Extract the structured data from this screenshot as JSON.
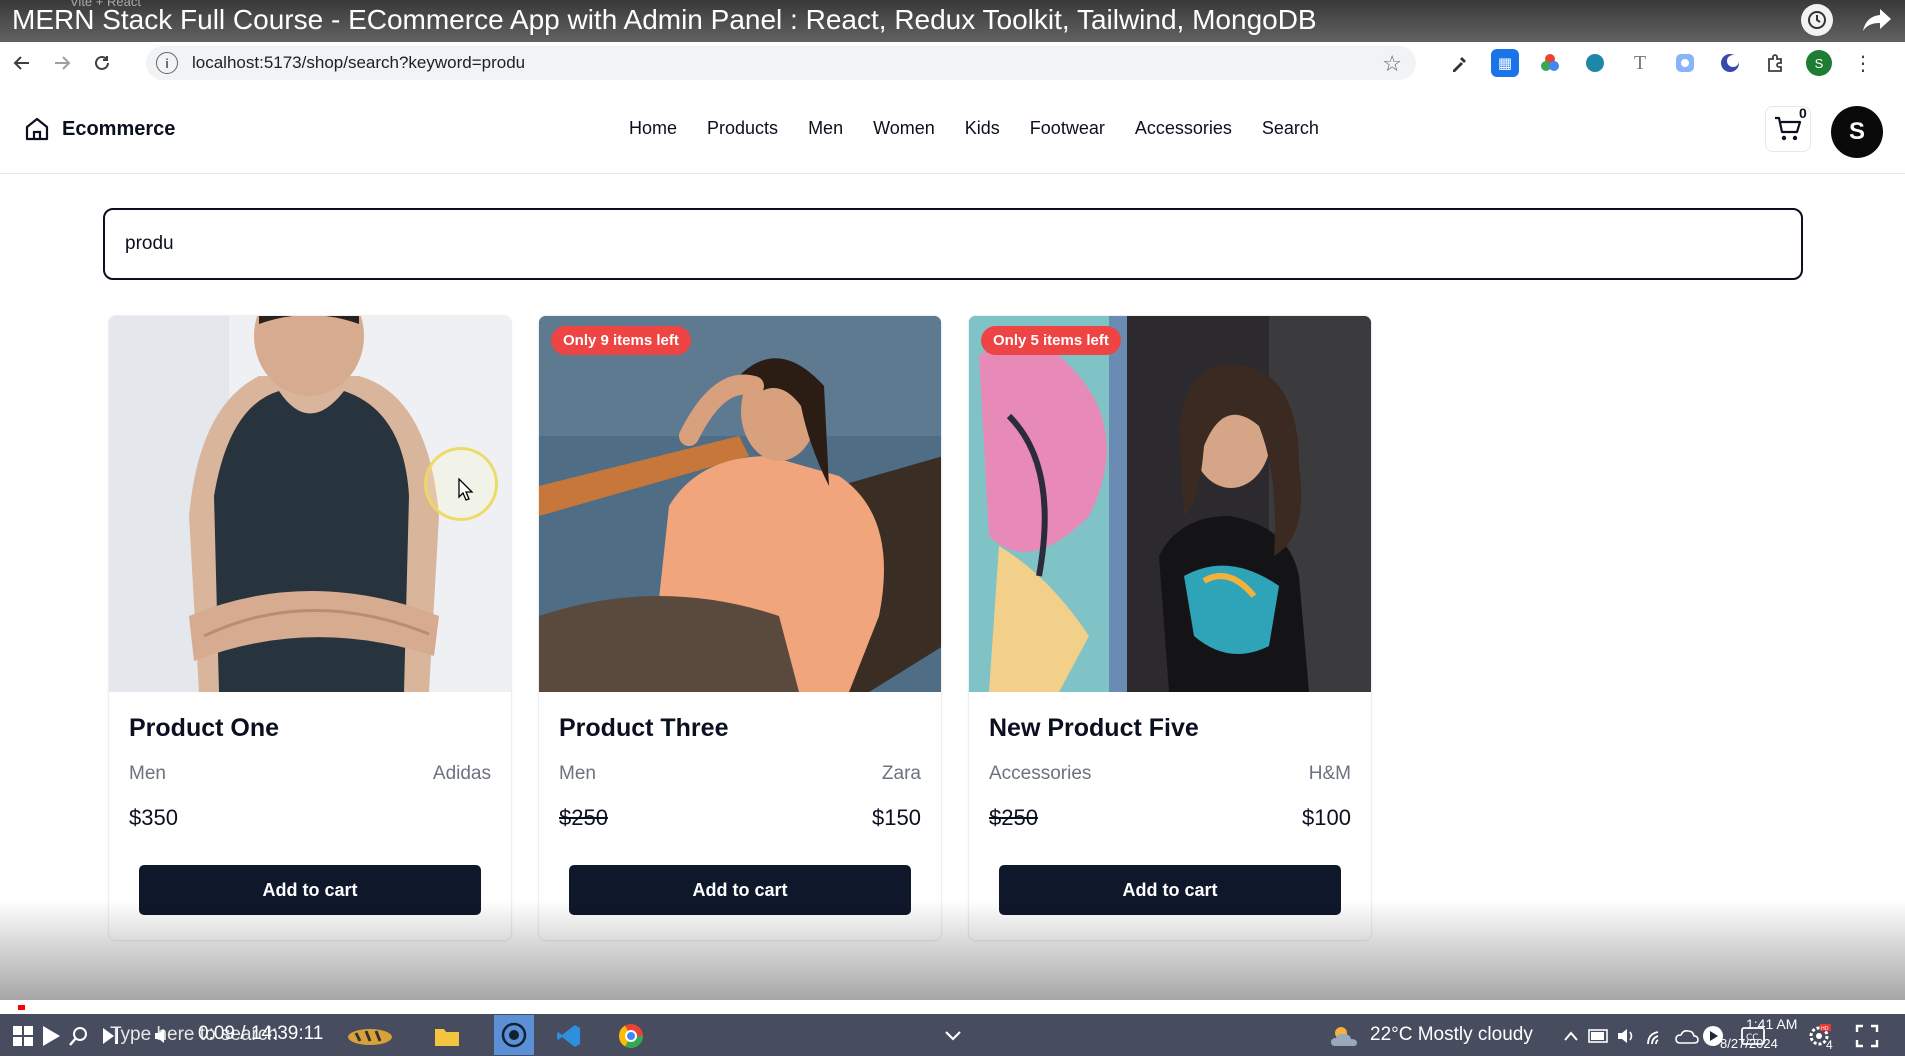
{
  "video": {
    "title": "MERN Stack Full Course - ECommerce App with Admin Panel : React, Redux Toolkit, Tailwind, MongoDB",
    "time": "0:09 / 14:39:11",
    "progress": 0.0002
  },
  "browser": {
    "url": "localhost:5173/shop/search?keyword=produ",
    "profile_initial": "S",
    "tab_fragment": "Vite + React"
  },
  "header": {
    "brand": "Ecommerce",
    "menu": [
      "Home",
      "Products",
      "Men",
      "Women",
      "Kids",
      "Footwear",
      "Accessories",
      "Search"
    ],
    "cart_count": "0",
    "avatar_initial": "S"
  },
  "search": {
    "value": "produ"
  },
  "products": [
    {
      "title": "Product One",
      "category": "Men",
      "brand": "Adidas",
      "price": "$350",
      "sale_price": "",
      "badge": "",
      "button": "Add to cart"
    },
    {
      "title": "Product Three",
      "category": "Men",
      "brand": "Zara",
      "price": "$250",
      "sale_price": "$150",
      "badge": "Only 9 items left",
      "button": "Add to cart"
    },
    {
      "title": "New Product Five",
      "category": "Accessories",
      "brand": "H&M",
      "price": "$250",
      "sale_price": "$100",
      "badge": "Only 5 items left",
      "button": "Add to cart"
    }
  ],
  "taskbar": {
    "search_placeholder": "Type here to search",
    "weather": "22°C  Mostly cloudy",
    "clock_time": "1:41 AM",
    "clock_date": "8/27/2024",
    "notifications": "4"
  }
}
